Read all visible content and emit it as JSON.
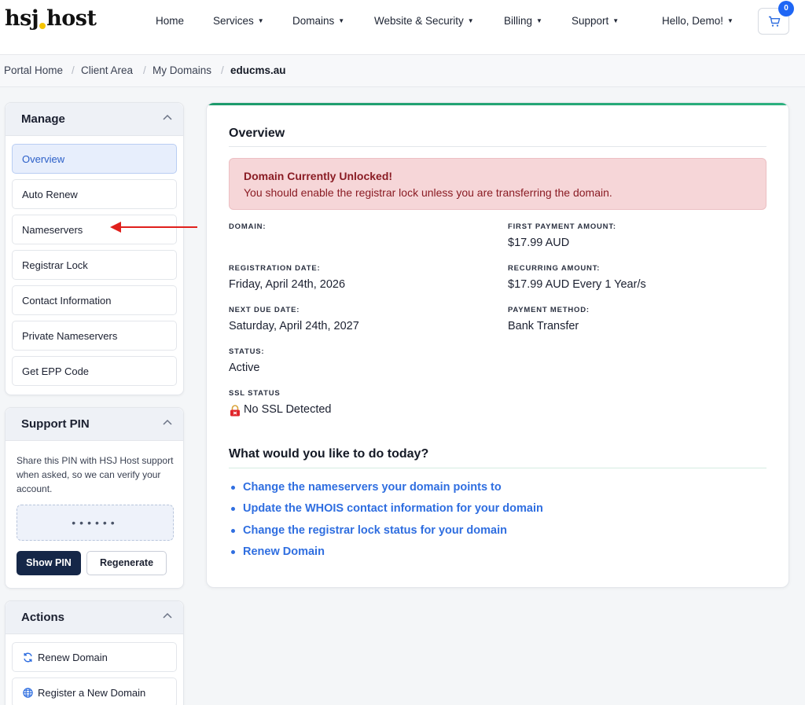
{
  "header": {
    "logo_left": "hsj",
    "logo_right": "host",
    "nav": [
      {
        "label": "Home",
        "dropdown": false
      },
      {
        "label": "Services",
        "dropdown": true
      },
      {
        "label": "Domains",
        "dropdown": true
      },
      {
        "label": "Website & Security",
        "dropdown": true
      },
      {
        "label": "Billing",
        "dropdown": true
      },
      {
        "label": "Support",
        "dropdown": true
      },
      {
        "label": "Hello, Demo!",
        "dropdown": true
      }
    ],
    "cart_count": "0"
  },
  "breadcrumb": [
    "Portal Home",
    "Client Area",
    "My Domains",
    "educms.au"
  ],
  "sidebar": {
    "manage": {
      "title": "Manage",
      "items": [
        "Overview",
        "Auto Renew",
        "Nameservers",
        "Registrar Lock",
        "Contact Information",
        "Private Nameservers",
        "Get EPP Code"
      ],
      "active": "Overview"
    },
    "support_pin": {
      "title": "Support PIN",
      "description": "Share this PIN with HSJ Host support when asked, so we can verify your account.",
      "masked_pin": "••••••",
      "show_label": "Show PIN",
      "regenerate_label": "Regenerate"
    },
    "actions": {
      "title": "Actions",
      "items": [
        {
          "label": "Renew Domain",
          "icon": "refresh-icon"
        },
        {
          "label": "Register a New Domain",
          "icon": "globe-icon"
        }
      ]
    }
  },
  "main": {
    "title": "Overview",
    "alert": {
      "title": "Domain Currently Unlocked!",
      "text": "You should enable the registrar lock unless you are transferring the domain."
    },
    "left_fields": [
      {
        "label": "DOMAIN:",
        "value": ""
      },
      {
        "label": "REGISTRATION DATE:",
        "value": "Friday, April 24th, 2026"
      },
      {
        "label": "NEXT DUE DATE:",
        "value": "Saturday, April 24th, 2027"
      },
      {
        "label": "STATUS:",
        "value": "Active"
      },
      {
        "label": "SSL STATUS",
        "value": "No SSL Detected"
      }
    ],
    "right_fields": [
      {
        "label": "FIRST PAYMENT AMOUNT:",
        "value": "$17.99 AUD"
      },
      {
        "label": "RECURRING AMOUNT:",
        "value": "$17.99 AUD Every 1 Year/s"
      },
      {
        "label": "PAYMENT METHOD:",
        "value": "Bank Transfer"
      }
    ],
    "actions_title": "What would you like to do today?",
    "actions": [
      "Change the nameservers your domain points to",
      "Update the WHOIS contact information for your domain",
      "Change the registrar lock status for your domain",
      "Renew Domain"
    ]
  },
  "colors": {
    "accent_blue": "#2f6ee0",
    "alert_bg": "#f6d6d8",
    "alert_text": "#8a1c24",
    "dark_button": "#152748",
    "top_accent": "#1c9a6b",
    "annotation_arrow": "#e0201c"
  }
}
